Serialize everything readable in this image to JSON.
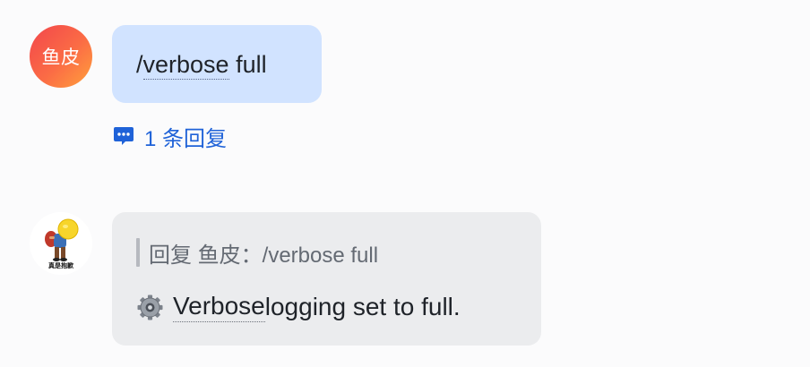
{
  "messages": [
    {
      "avatar_text": "鱼皮",
      "command_prefix": "/",
      "command_word": "verbose",
      "command_rest": " full",
      "reply_count_label": "1 条回复"
    },
    {
      "avatar_caption": "真是抱歉",
      "quote_text": "回复 鱼皮：/verbose full",
      "body_emoji": "⚙️",
      "body_word": "Verbose",
      "body_rest": " logging set to full."
    }
  ],
  "icons": {
    "reply": "comment-bubble-icon",
    "gear": "gear-icon"
  },
  "colors": {
    "own_bubble": "#d1e3ff",
    "bot_bubble": "#ebecee",
    "link": "#1f62d8",
    "avatar_gradient_start": "#f2464c",
    "avatar_gradient_end": "#ffa13c"
  }
}
